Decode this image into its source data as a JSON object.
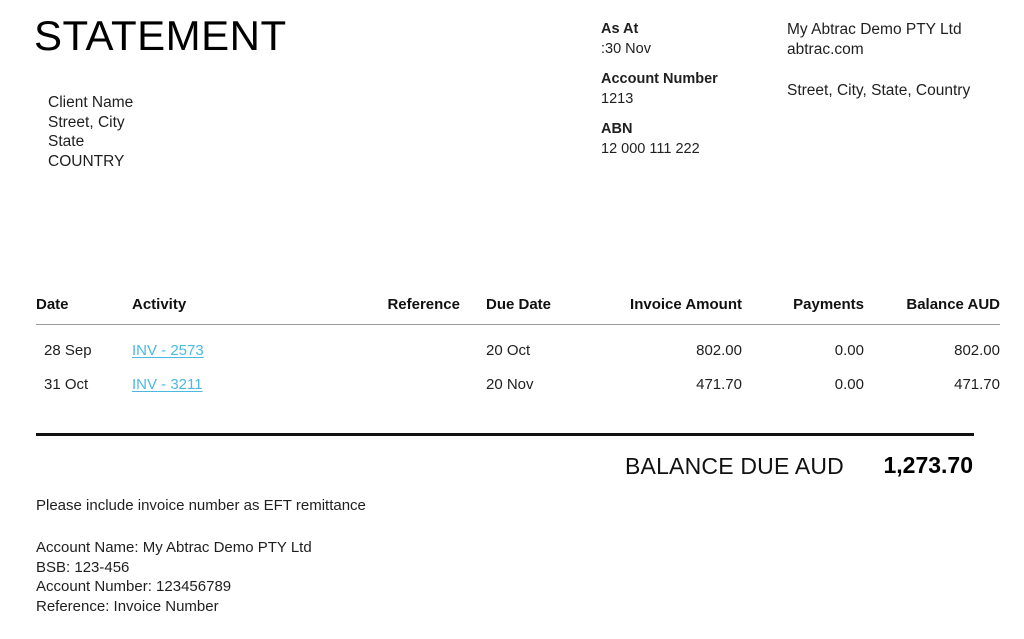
{
  "document": {
    "title": "STATEMENT"
  },
  "client": {
    "lines": [
      "Client Name",
      "Street, City",
      "State",
      "COUNTRY"
    ]
  },
  "meta": {
    "as_at_label": "As At",
    "as_at_value": ":30 Nov",
    "account_number_label": "Account Number",
    "account_number_value": "1213",
    "abn_label": "ABN",
    "abn_value": "12 000 111 222"
  },
  "company": {
    "name": "My Abtrac Demo PTY Ltd",
    "website": "abtrac.com",
    "address": "Street, City, State, Country"
  },
  "table": {
    "headers": {
      "date": "Date",
      "activity": "Activity",
      "reference": "Reference",
      "due_date": "Due Date",
      "invoice_amount": "Invoice Amount",
      "payments": "Payments",
      "balance": "Balance AUD"
    },
    "rows": [
      {
        "date": "28 Sep",
        "activity": "INV - 2573",
        "reference": "",
        "due_date": "20 Oct",
        "invoice_amount": "802.00",
        "payments": "0.00",
        "balance": "802.00"
      },
      {
        "date": "31 Oct",
        "activity": "INV - 3211",
        "reference": "",
        "due_date": "20 Nov",
        "invoice_amount": "471.70",
        "payments": "0.00",
        "balance": "471.70"
      }
    ]
  },
  "totals": {
    "balance_due_label": "BALANCE DUE AUD",
    "balance_due_amount": "1,273.70"
  },
  "footer": {
    "remittance_note": "Please include invoice number as EFT remittance",
    "account_name": "Account Name: My Abtrac Demo PTY Ltd",
    "bsb": "BSB: 123-456",
    "account_number": "Account Number: 123456789",
    "reference": "Reference: Invoice Number"
  },
  "colors": {
    "link": "#4cb9e2",
    "text": "#1f1f1f",
    "rule": "#111111",
    "header_rule": "#9a9a9a"
  }
}
